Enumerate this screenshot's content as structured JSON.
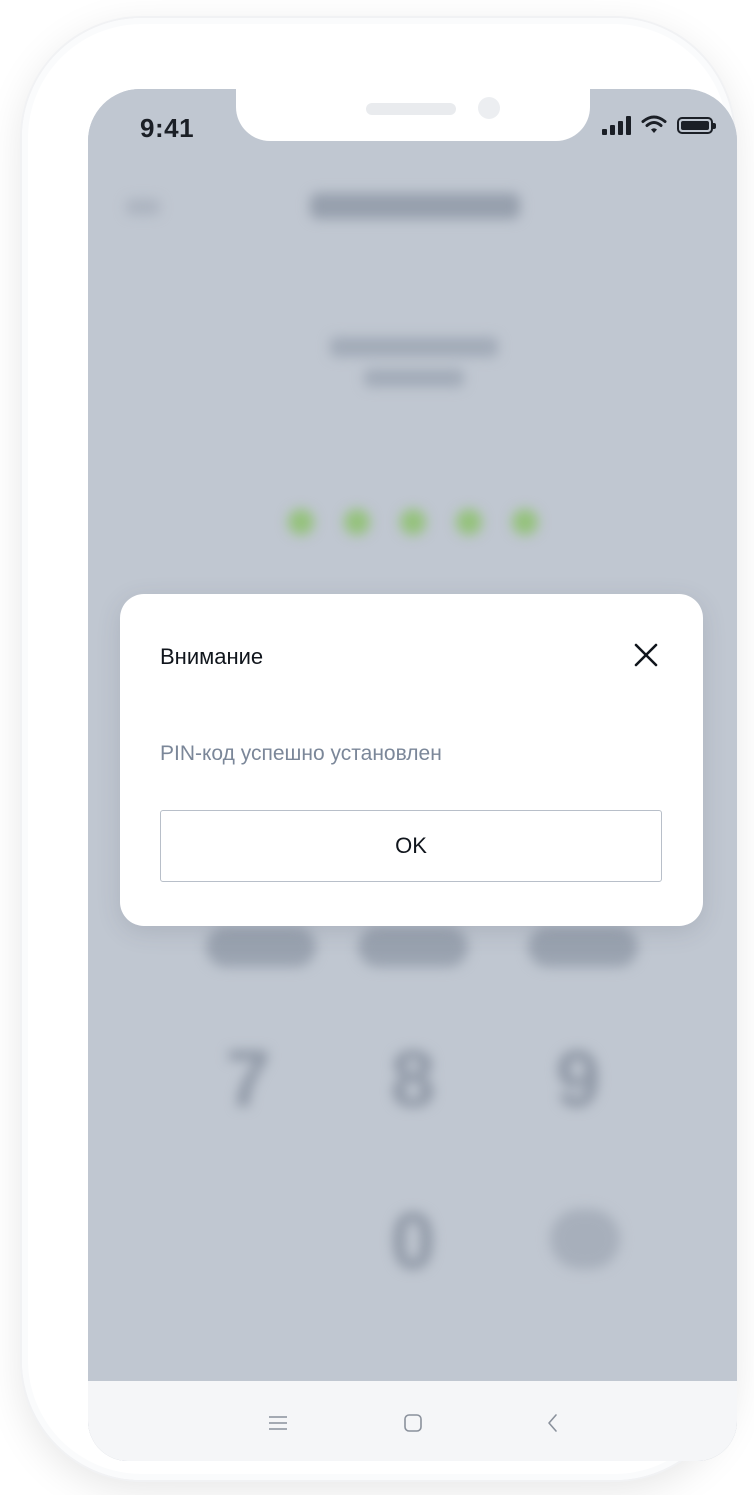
{
  "status_bar": {
    "time": "9:41"
  },
  "blurred_background": {
    "keypad": [
      "7",
      "8",
      "9",
      "0"
    ]
  },
  "dialog": {
    "title": "Внимание",
    "message": "PIN-код успешно установлен",
    "ok_label": "OK",
    "close_icon": "close-icon"
  },
  "colors": {
    "overlay": "#c0c7d1",
    "pin_dot": "#94c27b",
    "message_text": "#7b8799",
    "dialog_bg": "#ffffff"
  },
  "nav_bar": {
    "icons": [
      "menu-icon",
      "home-square-icon",
      "back-chevron-icon"
    ]
  }
}
